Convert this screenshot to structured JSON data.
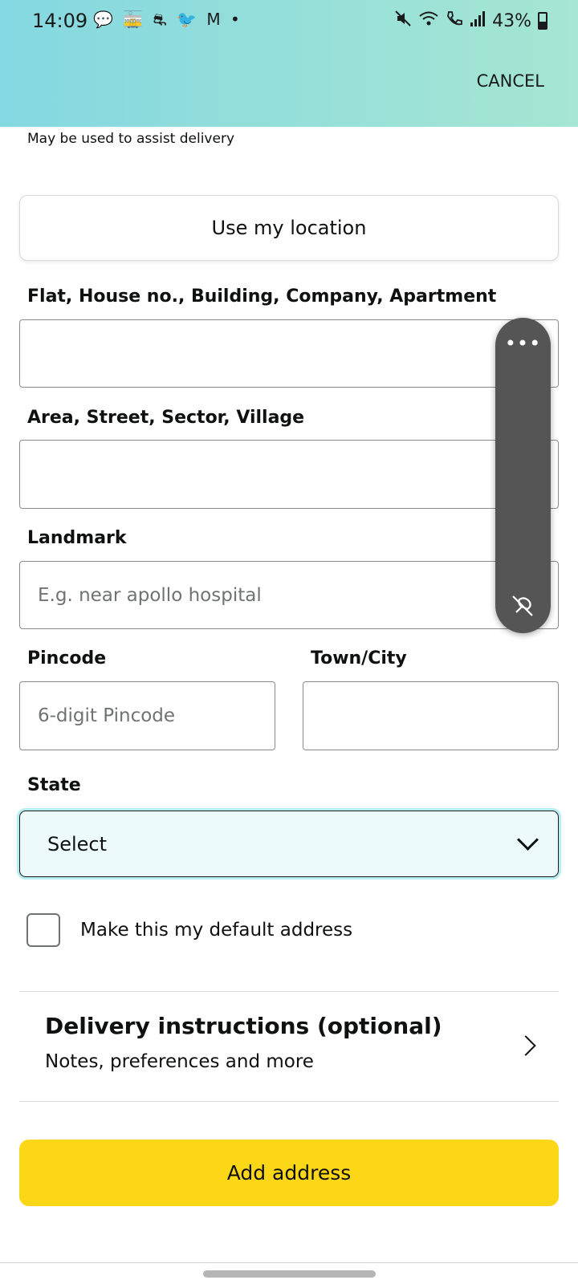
{
  "status_bar": {
    "time": "14:09",
    "notification_icons": "💬 🚋 ⛐ 🐦 M •",
    "battery": "43%",
    "battery_level": 0.43
  },
  "header": {
    "cancel_label": "CANCEL"
  },
  "hint_text": "May be used to assist delivery",
  "use_location_label": "Use my location",
  "form": {
    "flat_label": "Flat, House no., Building, Company, Apartment",
    "flat_value": "",
    "area_label": "Area, Street, Sector, Village",
    "area_value": "",
    "landmark_label": "Landmark",
    "landmark_placeholder": "E.g. near apollo hospital",
    "pincode_label": "Pincode",
    "pincode_placeholder": "6-digit Pincode",
    "city_label": "Town/City",
    "city_value": "",
    "state_label": "State",
    "state_selected": "Select",
    "default_address_label": "Make this my default address"
  },
  "delivery": {
    "title": "Delivery instructions (optional)",
    "subtitle": "Notes, preferences and more"
  },
  "add_button_label": "Add address",
  "colors": {
    "header_gradient_start": "#84d8e1",
    "header_gradient_end": "#a6e6d2",
    "primary_button": "#fcd718",
    "select_background": "#ecfafc",
    "floating_panel": "#555555"
  }
}
